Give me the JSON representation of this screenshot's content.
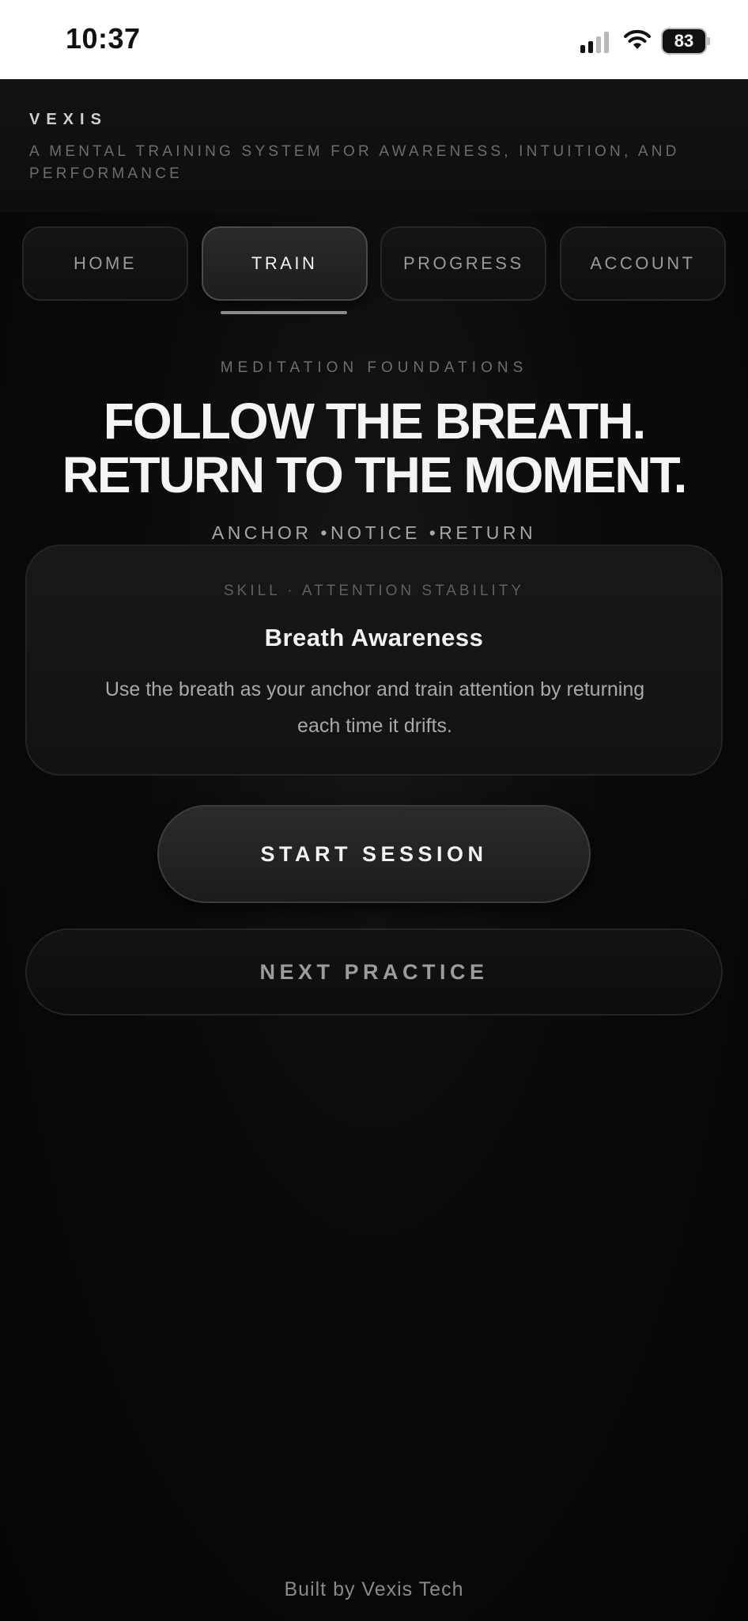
{
  "status_bar": {
    "time": "10:37",
    "battery_level": "83",
    "icons": [
      "cellular-signal-icon",
      "wifi-icon",
      "battery-icon"
    ]
  },
  "header": {
    "brand": "VEXIS",
    "tagline": "A MENTAL TRAINING SYSTEM FOR AWARENESS, INTUITION, AND PERFORMANCE"
  },
  "tabs": [
    {
      "label": "HOME",
      "active": false
    },
    {
      "label": "TRAIN",
      "active": true
    },
    {
      "label": "PROGRESS",
      "active": false
    },
    {
      "label": "ACCOUNT",
      "active": false
    }
  ],
  "hero": {
    "eyebrow": "MEDITATION FOUNDATIONS",
    "headline_line1": "FOLLOW THE BREATH.",
    "headline_line2": "RETURN TO THE MOMENT.",
    "pillars": "ANCHOR •NOTICE •RETURN"
  },
  "card": {
    "eyebrow": "SKILL · ATTENTION STABILITY",
    "title": "Breath Awareness",
    "description": "Use the breath as your anchor and train attention by returning each time it drifts."
  },
  "actions": {
    "start_label": "START SESSION",
    "next_label": "NEXT PRACTICE"
  },
  "footer": {
    "text": "Built by Vexis Tech"
  },
  "colors": {
    "background": "#050505",
    "status_bar": "#ffffff",
    "headline": "#f4f4f4",
    "muted_text": "#6e6e6e",
    "active_tab": "#2a2a2a"
  }
}
